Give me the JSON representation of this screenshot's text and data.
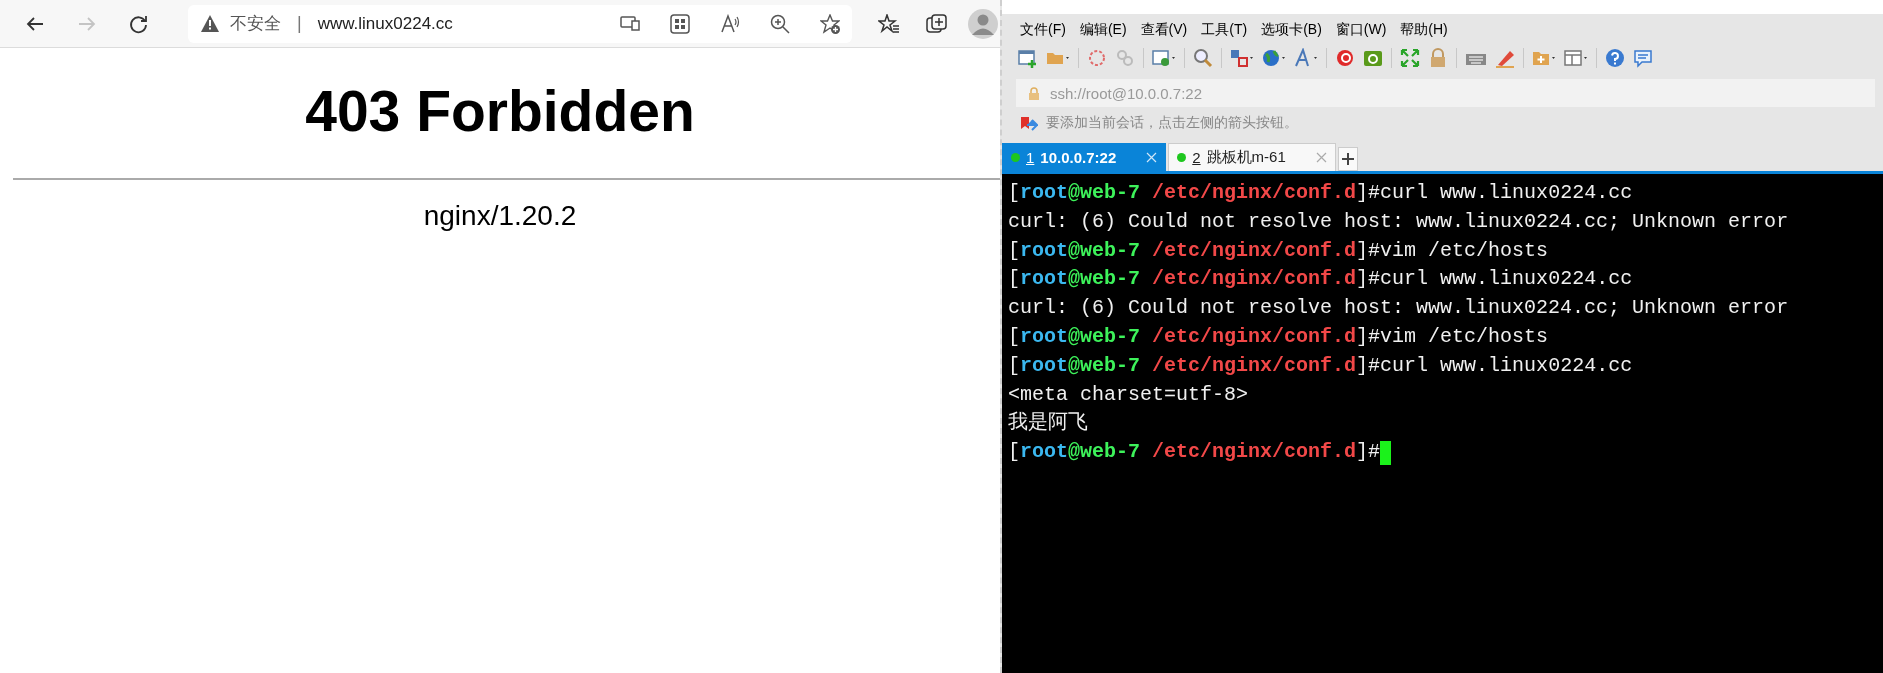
{
  "browser": {
    "nav_buttons": [
      {
        "kind": "back",
        "disabled": false
      },
      {
        "kind": "forward",
        "disabled": true
      },
      {
        "kind": "refresh",
        "disabled": false
      }
    ],
    "address": {
      "security": "不安全",
      "separator": "|",
      "url": "www.linux0224.cc"
    },
    "page": {
      "heading": "403 Forbidden",
      "server": "nginx/1.20.2"
    }
  },
  "xshell": {
    "menu": [
      "文件(F)",
      "编辑(E)",
      "查看(V)",
      "工具(T)",
      "选项卡(B)",
      "窗口(W)",
      "帮助(H)"
    ],
    "address": "ssh://root@10.0.0.7:22",
    "hint": "要添加当前会话，点击左侧的箭头按钮。",
    "tabs": [
      {
        "number": "1",
        "label": "10.0.0.7:22",
        "selected": true,
        "color": "#1ec71e"
      },
      {
        "number": "2",
        "label": "跳板机m-61",
        "selected": false,
        "color": "#1ec71e"
      }
    ],
    "terminal": {
      "lines": [
        {
          "cursor": false,
          "segments": [
            {
              "kind": "plain",
              "text": "["
            },
            {
              "kind": "user",
              "text": "root"
            },
            {
              "kind": "host",
              "text": "@web-7"
            },
            {
              "kind": "path",
              "text": " /etc/nginx/conf.d"
            },
            {
              "kind": "plain",
              "text": "]#curl www.linux0224.cc"
            }
          ]
        },
        {
          "cursor": false,
          "segments": [
            {
              "kind": "plain",
              "text": "curl: (6) Could not resolve host: www.linux0224.cc; Unknown error"
            }
          ]
        },
        {
          "cursor": false,
          "segments": [
            {
              "kind": "plain",
              "text": "["
            },
            {
              "kind": "user",
              "text": "root"
            },
            {
              "kind": "host",
              "text": "@web-7"
            },
            {
              "kind": "path",
              "text": " /etc/nginx/conf.d"
            },
            {
              "kind": "plain",
              "text": "]#vim /etc/hosts"
            }
          ]
        },
        {
          "cursor": false,
          "segments": [
            {
              "kind": "plain",
              "text": "["
            },
            {
              "kind": "user",
              "text": "root"
            },
            {
              "kind": "host",
              "text": "@web-7"
            },
            {
              "kind": "path",
              "text": " /etc/nginx/conf.d"
            },
            {
              "kind": "plain",
              "text": "]#curl www.linux0224.cc"
            }
          ]
        },
        {
          "cursor": false,
          "segments": [
            {
              "kind": "plain",
              "text": "curl: (6) Could not resolve host: www.linux0224.cc; Unknown error"
            }
          ]
        },
        {
          "cursor": false,
          "segments": [
            {
              "kind": "plain",
              "text": "["
            },
            {
              "kind": "user",
              "text": "root"
            },
            {
              "kind": "host",
              "text": "@web-7"
            },
            {
              "kind": "path",
              "text": " /etc/nginx/conf.d"
            },
            {
              "kind": "plain",
              "text": "]#vim /etc/hosts"
            }
          ]
        },
        {
          "cursor": false,
          "segments": [
            {
              "kind": "plain",
              "text": "["
            },
            {
              "kind": "user",
              "text": "root"
            },
            {
              "kind": "host",
              "text": "@web-7"
            },
            {
              "kind": "path",
              "text": " /etc/nginx/conf.d"
            },
            {
              "kind": "plain",
              "text": "]#curl www.linux0224.cc"
            }
          ]
        },
        {
          "cursor": false,
          "segments": [
            {
              "kind": "plain",
              "text": "<meta charset=utf-8>"
            }
          ]
        },
        {
          "cursor": false,
          "segments": [
            {
              "kind": "plain",
              "text": "我是阿飞"
            }
          ]
        },
        {
          "cursor": true,
          "segments": [
            {
              "kind": "plain",
              "text": "["
            },
            {
              "kind": "user",
              "text": "root"
            },
            {
              "kind": "host",
              "text": "@web-7"
            },
            {
              "kind": "path",
              "text": " /etc/nginx/conf.d"
            },
            {
              "kind": "plain",
              "text": "]#"
            }
          ]
        }
      ]
    }
  }
}
